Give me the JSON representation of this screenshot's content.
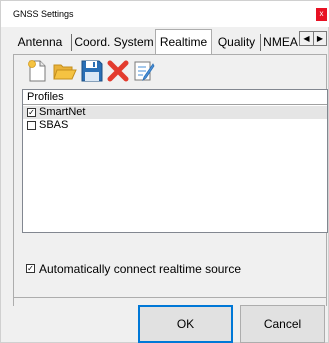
{
  "window": {
    "title": "GNSS Settings",
    "close_glyph": "x"
  },
  "tabs": [
    {
      "label": "Antenna",
      "active": false
    },
    {
      "label": "Coord. System",
      "active": false
    },
    {
      "label": "Realtime",
      "active": true
    },
    {
      "label": "Quality",
      "active": false
    },
    {
      "label": "NMEA",
      "active": false
    }
  ],
  "tab_scroll": {
    "left_glyph": "◀",
    "right_glyph": "▶"
  },
  "toolbar": {
    "icons": [
      "new-file-icon",
      "open-folder-icon",
      "save-icon",
      "delete-icon",
      "edit-icon"
    ],
    "accent_colors": {
      "folder": "#f5c342",
      "save": "#2a6fb5",
      "delete": "#e33b2e",
      "edit": "#4a90d9"
    }
  },
  "profiles": {
    "header": "Profiles",
    "items": [
      {
        "label": "SmartNet",
        "checked": true,
        "selected": true,
        "check_glyph": "✓"
      },
      {
        "label": "SBAS",
        "checked": false,
        "selected": false,
        "check_glyph": ""
      }
    ]
  },
  "auto_connect": {
    "label": "Automatically connect realtime source",
    "checked": true,
    "check_glyph": "✓"
  },
  "buttons": {
    "ok_label": "OK",
    "cancel_label": "Cancel"
  }
}
